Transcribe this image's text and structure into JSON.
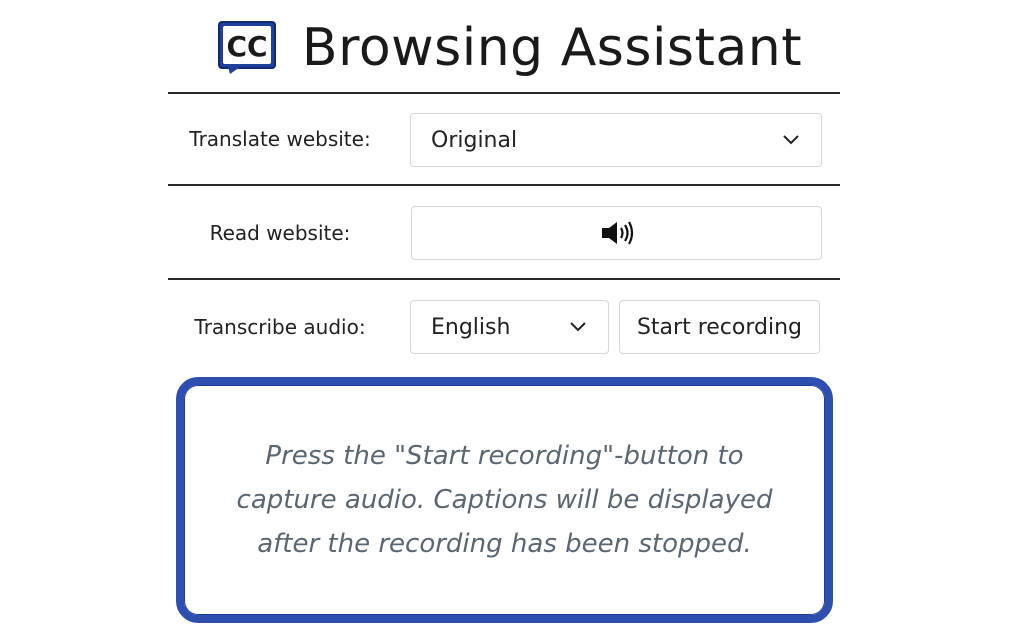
{
  "header": {
    "logo_text": "CC",
    "title": "Browsing Assistant"
  },
  "translate": {
    "label": "Translate website:",
    "selected": "Original"
  },
  "read": {
    "label": "Read website:",
    "icon": "speaker-icon"
  },
  "transcribe": {
    "label": "Transcribe audio:",
    "language_selected": "English",
    "button_label": "Start recording"
  },
  "caption": {
    "text": "Press the \"Start recording\"-button to capture audio. Captions will be displayed after the recording has been stopped."
  },
  "colors": {
    "accent": "#2f4fb0",
    "logo_blue": "#1f3f9a"
  }
}
